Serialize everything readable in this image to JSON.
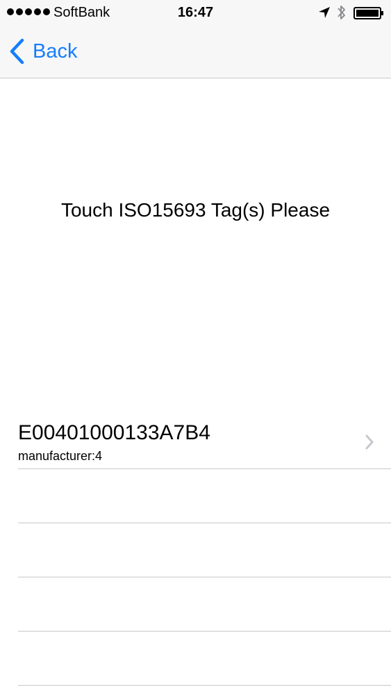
{
  "status_bar": {
    "carrier": "SoftBank",
    "time": "16:47",
    "signal_bars": 5,
    "icons": [
      "location-arrow-icon",
      "bluetooth-icon",
      "battery-icon"
    ]
  },
  "nav": {
    "back_label": "Back",
    "tint_color": "#157efb"
  },
  "main": {
    "prompt": "Touch ISO15693 Tag(s) Please"
  },
  "tags": [
    {
      "id": "E00401000133A7B4",
      "detail": "manufacturer:4"
    }
  ],
  "colors": {
    "separator": "#c8c7cc",
    "nav_background": "#f7f7f8",
    "disclosure": "#c7c7cc"
  }
}
